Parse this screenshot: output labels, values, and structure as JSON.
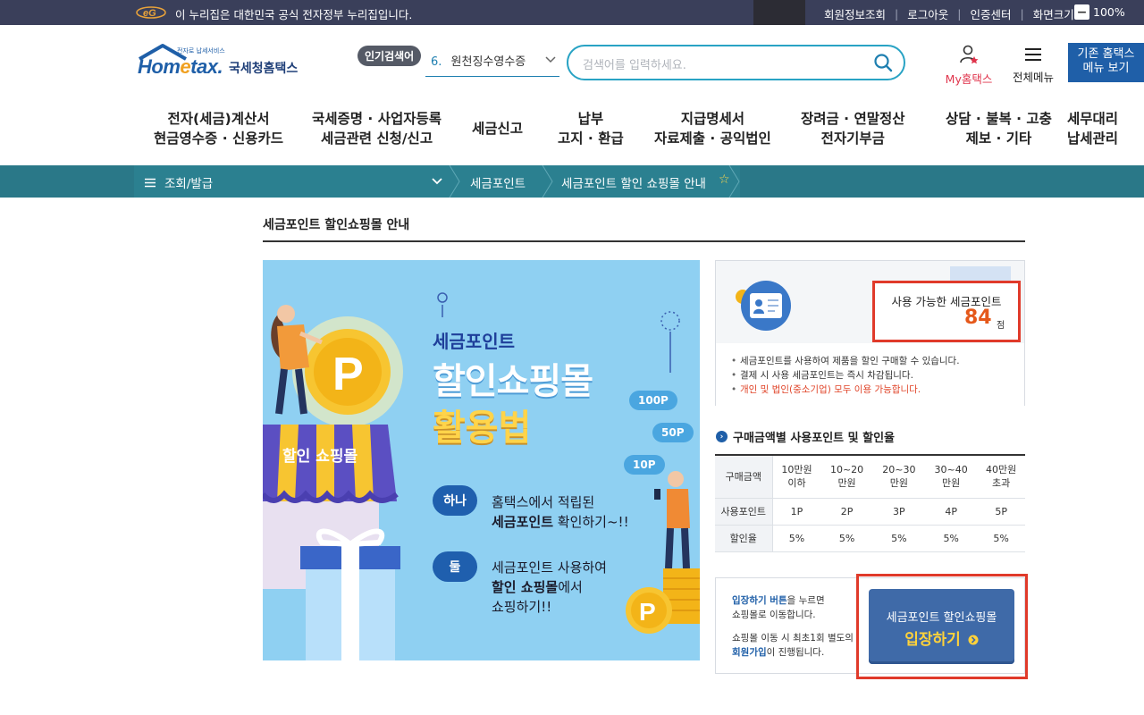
{
  "gov_bar": {
    "notice": "이 누리집은 대한민국 공식 전자정부 누리집입니다.",
    "links": [
      "회원정보조회",
      "로그아웃",
      "인증센터",
      "화면크기"
    ],
    "zoom_minus": "−",
    "zoom_value": "100%"
  },
  "header": {
    "logo_tagline": "전자로 납세서비스",
    "logo_brand_a": "Hom",
    "logo_brand_e": "e",
    "logo_brand_b": "tax.",
    "logo_korean": "국세청홈택스",
    "popular_badge": "인기검색어",
    "popular_rank": "6.",
    "popular_term": "원천징수영수증",
    "search_placeholder": "검색어를 입력하세요.",
    "my_hometax": "My홈택스",
    "all_menu": "전체메뉴",
    "old_menu_line1": "기존 홈택스",
    "old_menu_line2": "메뉴 보기"
  },
  "nav": {
    "items": [
      {
        "line1": "전자(세금)계산서",
        "line2": "현금영수증 · 신용카드"
      },
      {
        "line1": "국세증명 · 사업자등록",
        "line2": "세금관련 신청/신고"
      },
      {
        "line1": "세금신고",
        "line2": ""
      },
      {
        "line1": "납부",
        "line2": "고지 · 환급"
      },
      {
        "line1": "지급명세서",
        "line2": "자료제출 · 공익법인"
      },
      {
        "line1": "장려금 · 연말정산",
        "line2": "전자기부금"
      },
      {
        "line1": "상담 · 불복 · 고충",
        "line2": "제보 · 기타"
      },
      {
        "line1": "세무대리",
        "line2": "납세관리"
      }
    ]
  },
  "breadcrumb": {
    "menu": "조회/발급",
    "level2": "세금포인트",
    "level3": "세금포인트 할인 쇼핑몰 안내"
  },
  "page": {
    "title": "세금포인트 할인쇼핑몰 안내"
  },
  "banner": {
    "title_small": "세금포인트",
    "title_big": "할인쇼핑몰",
    "title_yellow": "활용법",
    "awning": "할인 쇼핑몰",
    "bubbles": [
      "100P",
      "50P",
      "10P"
    ],
    "step1_badge": "하나",
    "step1_line1": "홈택스에서 적립된",
    "step1_line2_bold": "세금포인트",
    "step1_line2_rest": " 확인하기~!!",
    "step2_badge": "둘",
    "step2_line1": "세금포인트 사용하여",
    "step2_line2_bold": "할인 쇼핑몰",
    "step2_line2_rest": "에서",
    "step2_line3": "쇼핑하기!!"
  },
  "points": {
    "label": "사용 가능한 세금포인트",
    "value": "84",
    "unit": "점",
    "bullets": [
      "세금포인트를 사용하여 제품을 할인 구매할 수 있습니다.",
      "결제 시 사용 세금포인트는 즉시 차감됩니다.",
      "개인 및 법인(중소기업) 모두 이용 가능합니다."
    ]
  },
  "rate_table": {
    "title": "구매금액별 사용포인트 및 할인율",
    "header_label": "구매금액",
    "columns": [
      {
        "a": "10만원",
        "b": "이하"
      },
      {
        "a": "10~20",
        "b": "만원"
      },
      {
        "a": "20~30",
        "b": "만원"
      },
      {
        "a": "30~40",
        "b": "만원"
      },
      {
        "a": "40만원",
        "b": "초과"
      }
    ],
    "row_points_label": "사용포인트",
    "row_points": [
      "1P",
      "2P",
      "3P",
      "4P",
      "5P"
    ],
    "row_rate_label": "할인율",
    "row_rate": [
      "5%",
      "5%",
      "5%",
      "5%",
      "5%"
    ]
  },
  "entry": {
    "text1_blue": "입장하기 버튼",
    "text1_rest": "을 누르면",
    "text2": "쇼핑몰로 이동합니다.",
    "text3": "쇼핑몰 이동 시 최초1회 별도의",
    "text4_blue": "회원가입",
    "text4_rest": "이 진행됩니다.",
    "button_line1": "세금포인트 할인쇼핑몰",
    "button_line2": "입장하기"
  },
  "colors": {
    "accent_red": "#e03a2a",
    "teal_bar": "#2b8090",
    "brand_blue": "#1f5fa8",
    "points_orange": "#e5581a"
  }
}
